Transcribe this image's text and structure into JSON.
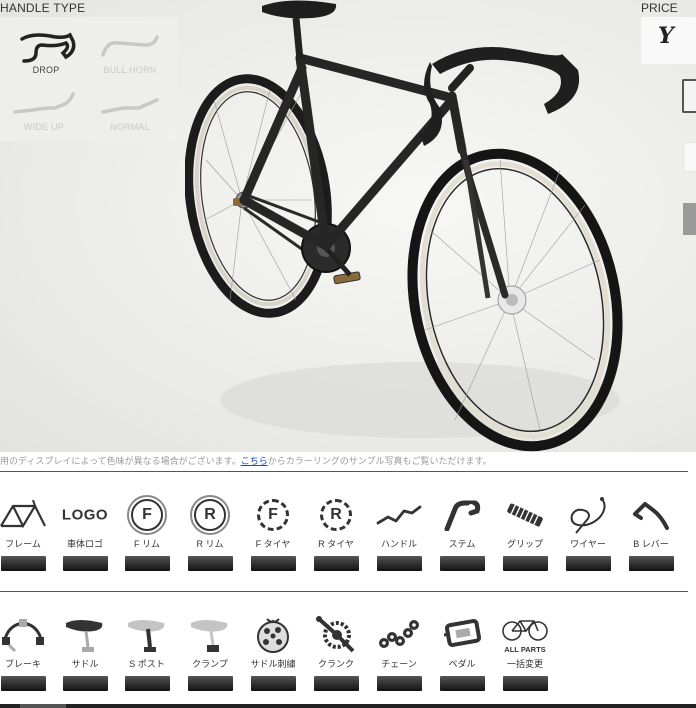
{
  "handle": {
    "title": "HANDLE TYPE",
    "options": [
      {
        "label": "DROP",
        "selected": true
      },
      {
        "label": "BULL HORN",
        "selected": false
      },
      {
        "label": "WIDE UP",
        "selected": false
      },
      {
        "label": "NORMAL",
        "selected": false
      }
    ]
  },
  "price": {
    "title": "PRICE",
    "currency_symbol": "Y"
  },
  "notice": {
    "before": "用のディスプレイによって色味が異なる場合がございます。",
    "link": "こちら",
    "after": "からカラーリングのサンプル写真もご覧いただけます。"
  },
  "parts_row1": [
    {
      "icon": "frame-icon",
      "label": "フレーム"
    },
    {
      "icon": "logo-icon",
      "label": "車体ロゴ",
      "icon_text": "LOGO"
    },
    {
      "icon": "front-rim-icon",
      "label": "F リム",
      "icon_text": "F"
    },
    {
      "icon": "rear-rim-icon",
      "label": "R リム",
      "icon_text": "R"
    },
    {
      "icon": "front-tire-icon",
      "label": "F タイヤ",
      "icon_text": "F"
    },
    {
      "icon": "rear-tire-icon",
      "label": "R タイヤ",
      "icon_text": "R"
    },
    {
      "icon": "handlebar-icon",
      "label": "ハンドル"
    },
    {
      "icon": "stem-icon",
      "label": "ステム"
    },
    {
      "icon": "grip-icon",
      "label": "グリップ"
    },
    {
      "icon": "wire-icon",
      "label": "ワイヤー"
    },
    {
      "icon": "brake-lever-icon",
      "label": "B レバー"
    }
  ],
  "parts_row2": [
    {
      "icon": "brake-icon",
      "label": "ブレーキ"
    },
    {
      "icon": "saddle-icon",
      "label": "サドル"
    },
    {
      "icon": "seat-post-icon",
      "label": "S ポスト"
    },
    {
      "icon": "clamp-icon",
      "label": "クランプ"
    },
    {
      "icon": "saddle-embroidery-icon",
      "label": "サドル刺繍"
    },
    {
      "icon": "crank-icon",
      "label": "クランク"
    },
    {
      "icon": "chain-icon",
      "label": "チェーン"
    },
    {
      "icon": "pedal-icon",
      "label": "ペダル"
    },
    {
      "icon": "all-parts-icon",
      "label": "一括変更",
      "icon_text": "ALL PARTS"
    }
  ]
}
